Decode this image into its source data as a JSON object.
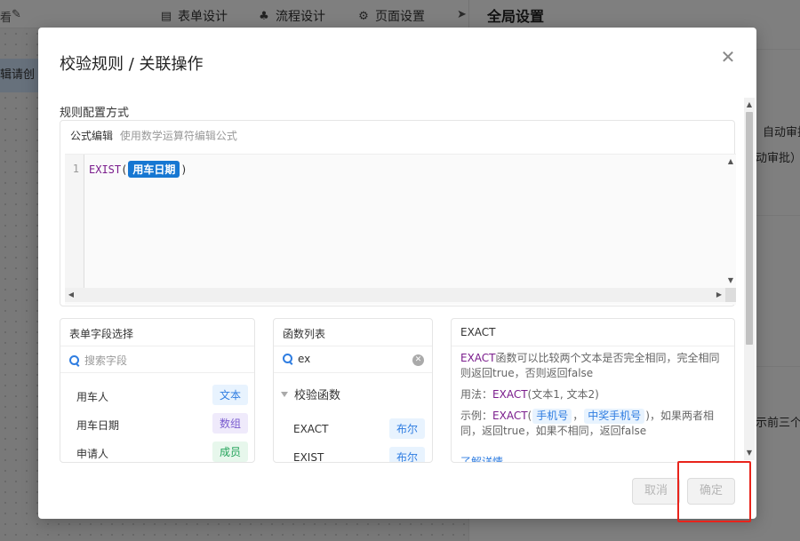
{
  "background": {
    "left_toptext": "看",
    "nav": [
      {
        "icon": "document-icon",
        "label": "表单设计"
      },
      {
        "icon": "flow-icon",
        "label": "流程设计"
      },
      {
        "icon": "gear-icon",
        "label": "页面设置"
      }
    ],
    "left_tag": "辑请创",
    "panel_title": "全局设置",
    "panel_texts": [
      "自动审批",
      "动审批）",
      "示前三个"
    ]
  },
  "modal": {
    "title": "校验规则 / 关联操作",
    "close_icon": "close-icon",
    "section_label": "规则配置方式",
    "formula": {
      "label": "公式编辑",
      "hint": "使用数学运算符编辑公式",
      "line_number": "1",
      "function_name": "EXIST",
      "open_paren": "(",
      "field_chip": "用车日期",
      "close_paren": ")"
    },
    "fields_panel": {
      "title": "表单字段选择",
      "search_placeholder": "搜索字段",
      "items": [
        {
          "name": "用车人",
          "type": "文本"
        },
        {
          "name": "用车日期",
          "type": "数组"
        },
        {
          "name": "申请人",
          "type": "成员"
        }
      ]
    },
    "functions_panel": {
      "title": "函数列表",
      "search_value": "ex",
      "group": "校验函数",
      "items": [
        {
          "name": "EXACT",
          "type": "布尔"
        },
        {
          "name": "EXIST",
          "type": "布尔"
        }
      ]
    },
    "detail_panel": {
      "title": "EXACT",
      "desc_fn": "EXACT",
      "desc_rest": "函数可以比较两个文本是否完全相同，完全相同则返回true，否则返回false",
      "usage_label": "用法：",
      "usage_fn": "EXACT",
      "usage_args": "(文本1, 文本2)",
      "example_label": "示例：",
      "example_fn": "EXACT",
      "example_open": "(",
      "example_arg1": "手机号",
      "example_comma": "，",
      "example_arg2": "中奖手机号",
      "example_rest": ")，如果两者相同，返回true，如果不相同，返回false",
      "link": "了解详情"
    },
    "buttons": {
      "cancel": "取消",
      "ok": "确定"
    }
  }
}
